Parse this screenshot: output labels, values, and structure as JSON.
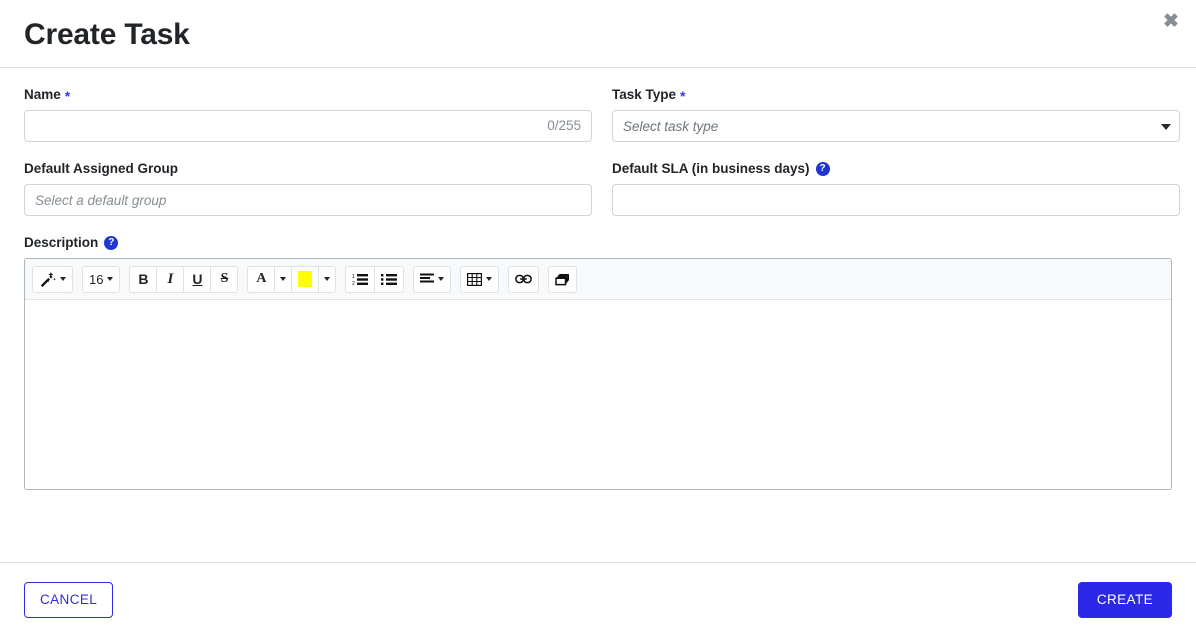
{
  "header": {
    "title": "Create Task",
    "close_label": "✖"
  },
  "form": {
    "name": {
      "label": "Name",
      "required_mark": "*",
      "value": "",
      "placeholder": "",
      "char_counter": "0/255"
    },
    "task_type": {
      "label": "Task Type",
      "required_mark": "*",
      "selected": "",
      "placeholder": "Select task type"
    },
    "default_assigned_group": {
      "label": "Default Assigned Group",
      "value": "",
      "placeholder": "Select a default group"
    },
    "default_sla": {
      "label": "Default SLA (in business days)",
      "help_glyph": "?",
      "value": "",
      "placeholder": ""
    },
    "description": {
      "label": "Description",
      "help_glyph": "?",
      "content": ""
    }
  },
  "editor_toolbar": {
    "style_picker": {
      "icon": "magic-wand-icon",
      "caret": "▾"
    },
    "font_size": {
      "value": "16",
      "caret": "▾"
    },
    "bold": {
      "label": "B"
    },
    "italic": {
      "label": "I"
    },
    "underline": {
      "label": "U"
    },
    "strikethrough": {
      "label": "S"
    },
    "font_color": {
      "label": "A",
      "caret": "▾"
    },
    "highlight_color": {
      "color": "#ffff00",
      "caret": "▾"
    },
    "ordered_list": {
      "icon": "ordered-list-icon"
    },
    "unordered_list": {
      "icon": "unordered-list-icon"
    },
    "align": {
      "icon": "align-left-icon",
      "caret": "▾"
    },
    "table": {
      "icon": "table-icon",
      "caret": "▾"
    },
    "link": {
      "icon": "link-icon"
    },
    "clear_format": {
      "icon": "eraser-icon"
    }
  },
  "footer": {
    "cancel_label": "CANCEL",
    "create_label": "CREATE"
  },
  "colors": {
    "accent": "#2b28e8",
    "accent_outline": "#2f2be6",
    "help_badge": "#1f36d6",
    "required_star": "#3b37e0",
    "highlight_swatch": "#ffff00",
    "border": "#ced4da",
    "toolbar_bg": "#f8f9fa",
    "muted_text": "#868e96"
  }
}
